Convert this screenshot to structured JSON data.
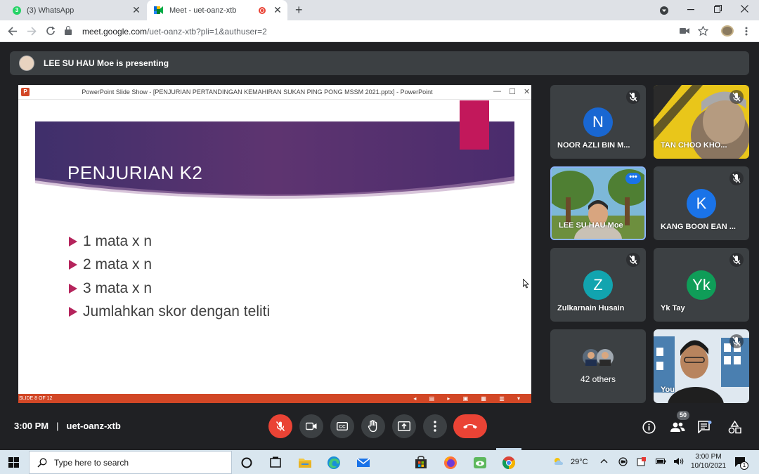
{
  "browser": {
    "tabs": [
      {
        "label": "(3) WhatsApp",
        "badge": "3",
        "favicon": "whatsapp-icon"
      },
      {
        "label": "Meet - uet-oanz-xtb",
        "favicon": "google-meet-icon",
        "recording": true
      }
    ],
    "url_host": "meet.google.com",
    "url_path": "/uet-oanz-xtb?pli=1&authuser=2"
  },
  "presenting_banner": "LEE SU HAU Moe is presenting",
  "presentation": {
    "window_title": "PowerPoint Slide Show - [PENJURIAN PERTANDINGAN KEMAHIRAN SUKAN PING PONG MSSM 2021.pptx] - PowerPoint",
    "app_icon_letter": "P",
    "slide_title": "PENJURIAN K2",
    "bullets": [
      "1 mata x n",
      "2 mata x n",
      "3 mata x n",
      "Jumlahkan skor dengan teliti"
    ],
    "status": "SLIDE 8 OF 12"
  },
  "participants": [
    {
      "name": "NOOR AZLI BIN M...",
      "initial": "N",
      "color": "#1967d2",
      "muted": true
    },
    {
      "name": "TAN CHOO KHO...",
      "video": true,
      "muted": true
    },
    {
      "name": "LEE SU HAU Moe",
      "video": true,
      "presenting": true
    },
    {
      "name": "KANG BOON EAN ...",
      "initial": "K",
      "color": "#1a73e8",
      "muted": true
    },
    {
      "name": "Zulkarnain Husain",
      "initial": "Z",
      "color": "#12a4af",
      "muted": true
    },
    {
      "name": "Yk Tay",
      "initial": "Yk",
      "color": "#0f9d58",
      "muted": true
    },
    {
      "others_label": "42 others"
    },
    {
      "name": "You",
      "video": true,
      "muted": true
    }
  ],
  "bottom_bar": {
    "time": "3:00 PM",
    "separator": "|",
    "meeting_code": "uet-oanz-xtb",
    "people_count": "50",
    "accent_red": "#ea4335"
  },
  "taskbar": {
    "search_placeholder": "Type here to search",
    "weather": "29°C",
    "time": "3:00 PM",
    "date": "10/10/2021",
    "notification_count": "1"
  }
}
